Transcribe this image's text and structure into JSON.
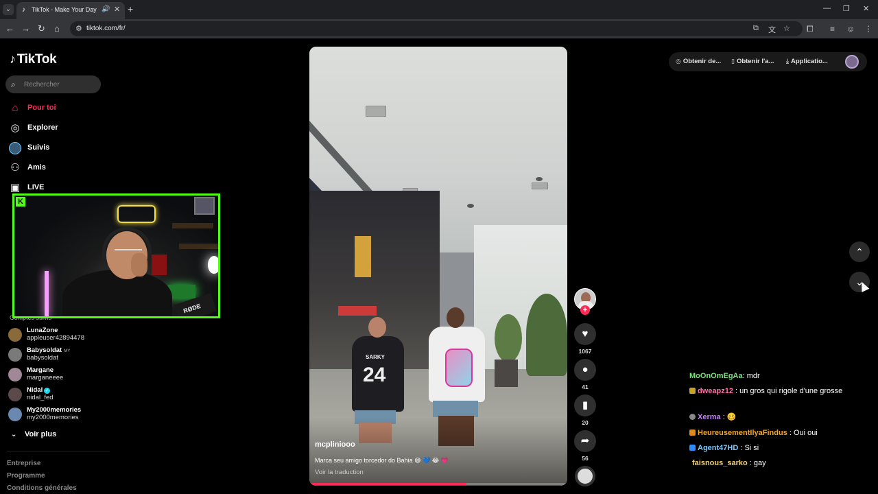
{
  "browser": {
    "tab_title": "TikTok - Make Your Day",
    "url": "tiktok.com/fr/"
  },
  "sidebar": {
    "logo": "TikTok",
    "search_placeholder": "Rechercher",
    "nav": [
      {
        "label": "Pour toi",
        "icon": "home-icon",
        "active": true
      },
      {
        "label": "Explorer",
        "icon": "compass-icon"
      },
      {
        "label": "Suivis",
        "icon": "following-avatar-icon"
      },
      {
        "label": "Amis",
        "icon": "friends-icon"
      },
      {
        "label": "LIVE",
        "icon": "live-tv-icon"
      }
    ],
    "following_header": "Comptes suivis",
    "accounts": [
      {
        "name": "LunaZone",
        "handle": "appleuser42894478",
        "color": "#8a6a3a"
      },
      {
        "name": "Babysoldat",
        "tag": "MY",
        "handle": "babysoldat",
        "color": "#7a7a7a"
      },
      {
        "name": "Margane",
        "handle": "marganeeee",
        "color": "#a08898"
      },
      {
        "name": "Nidal",
        "verified": true,
        "handle": "nidal_fed",
        "color": "#5a4a4a"
      },
      {
        "name": "My2000memories",
        "handle": "my2000memories",
        "color": "#6a88b0"
      }
    ],
    "see_more": "Voir plus",
    "footer": [
      "Entreprise",
      "Programme",
      "Conditions générales"
    ]
  },
  "webcam": {
    "mic_brand": "RØDE"
  },
  "video": {
    "author": "mcpliniooo",
    "caption": "Marca seu amigo torcedor do Bahia 😅 💙 😂 💗",
    "translate": "Voir la traduction",
    "jersey_name": "SARKY",
    "jersey_number": "24",
    "progress": 0.61
  },
  "actions": {
    "likes": "1067",
    "comments": "41",
    "saves": "20",
    "shares": "56"
  },
  "topbar": {
    "btn1": "Obtenir de...",
    "btn2": "Obtenir l'a...",
    "btn3": "Applicatio..."
  },
  "chat": [
    {
      "user": "MoOnOmEgAa",
      "msg": ": mdr",
      "color": "#7ee07e"
    },
    {
      "user": "dweapz12",
      "msg": " : un gros qui rigole d'une grosse",
      "color": "#ff6fa9",
      "badge": "#c9a227"
    },
    {
      "user": "Xerma",
      "msg": " : 🥴",
      "color": "#c47dff",
      "badge": "#888"
    },
    {
      "user": "HeureusementIlyaFindus",
      "msg": " : Oui oui",
      "color": "#f5a623",
      "badge": "#e08a1e"
    },
    {
      "user": "Agent47HD",
      "msg": " : Si si",
      "color": "#7ec8ff",
      "badge": "#2a8cff"
    },
    {
      "user": "faisnous_sarko",
      "msg": " : gay",
      "color": "#f5d37a"
    }
  ]
}
